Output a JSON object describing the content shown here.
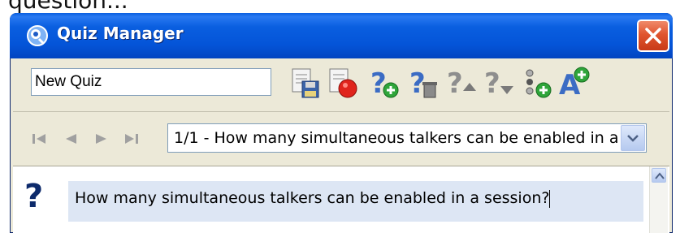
{
  "background": {
    "caption": "question..."
  },
  "window": {
    "title": "Quiz Manager",
    "close_icon": "close-icon"
  },
  "toolbar": {
    "quiz_name_value": "New Quiz",
    "tools": [
      "save-icon",
      "record-icon",
      "add-question-icon",
      "delete-question-icon",
      "move-question-up-icon",
      "move-question-down-icon",
      "add-choice-icon",
      "add-answer-icon"
    ]
  },
  "navigator": {
    "first_icon": "first-icon",
    "prev_icon": "prev-icon",
    "next_icon": "next-icon",
    "last_icon": "last-icon",
    "selected_question": "1/1 - How many simultaneous talkers can be enabled in a ..."
  },
  "question": {
    "marker": "?",
    "text": "How many simultaneous talkers can be enabled in a session?"
  },
  "colors": {
    "titlebar_blue": "#0454d8",
    "close_red": "#e0552f",
    "window_bg": "#ece9d8",
    "question_bg": "#dde6f4"
  }
}
